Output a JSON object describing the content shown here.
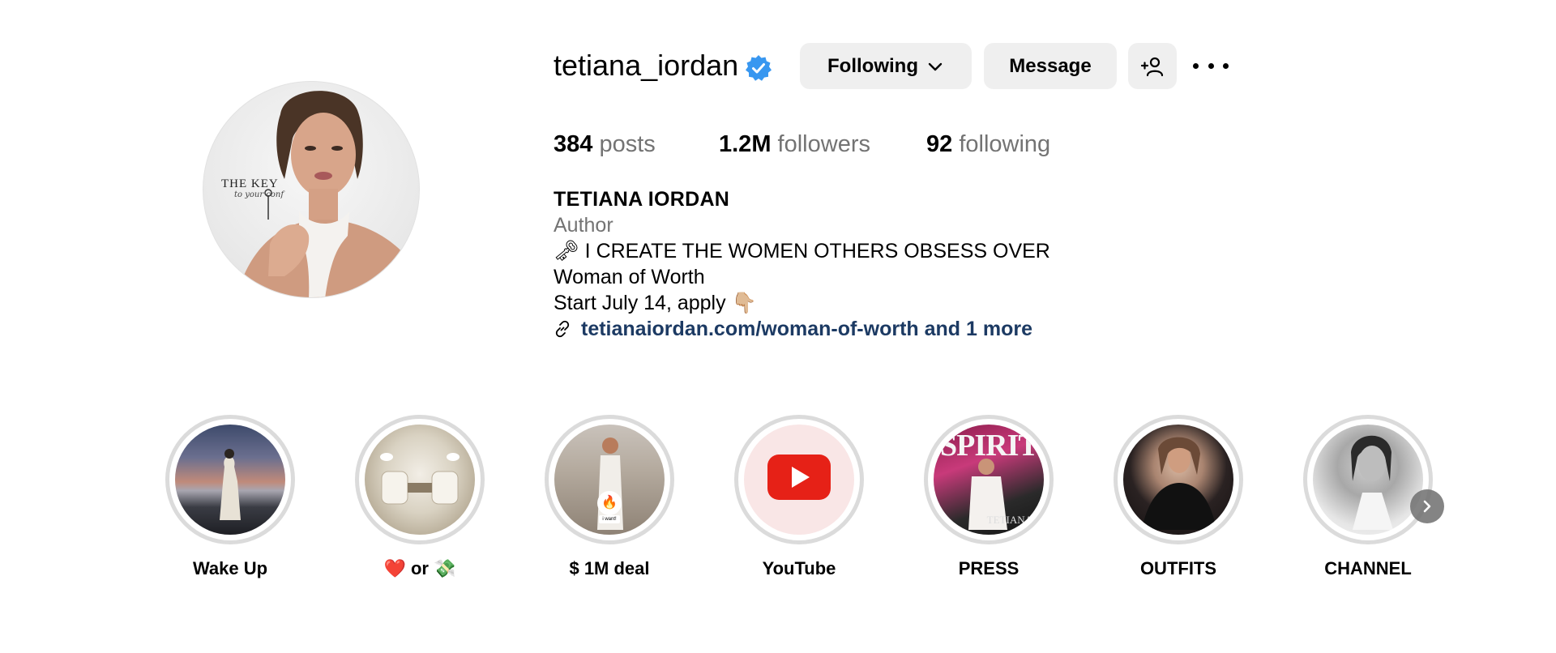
{
  "profile": {
    "username": "tetiana_iordan",
    "verified_icon": "verified-badge-icon",
    "avatar_logo": "THE KEY",
    "avatar_logo_sub": "to your conf"
  },
  "actions": {
    "following_label": "Following",
    "message_label": "Message",
    "add_user_icon": "add-person-icon",
    "more_icon": "more-options-icon"
  },
  "stats": {
    "posts_count": "384",
    "posts_label": "posts",
    "followers_count": "1.2M",
    "followers_label": "followers",
    "following_count": "92",
    "following_label": "following"
  },
  "bio": {
    "full_name": "TETIANA IORDAN",
    "category": "Author",
    "line1": "🗝 I CREATE THE WOMEN OTHERS OBSESS OVER",
    "line2": "Woman of Worth",
    "line3": "Start July 14, apply 👇🏼",
    "link_text": "tetianaiordan.com/woman-of-worth and 1 more"
  },
  "highlights": [
    {
      "label": "Wake Up"
    },
    {
      "label": "❤️ or 💸"
    },
    {
      "label": "$ 1M deal",
      "overlay_tag": "i want!"
    },
    {
      "label": "YouTube"
    },
    {
      "label": "PRESS",
      "cover_title": "SPIRIT",
      "cover_name": "TETIANA"
    },
    {
      "label": "OUTFITS"
    },
    {
      "label": "CHANNEL"
    }
  ],
  "colors": {
    "link": "#1c3a63",
    "verified": "#3897f0",
    "muted_text": "#737373",
    "button_bg": "#efefef",
    "youtube_red": "#e62117"
  }
}
